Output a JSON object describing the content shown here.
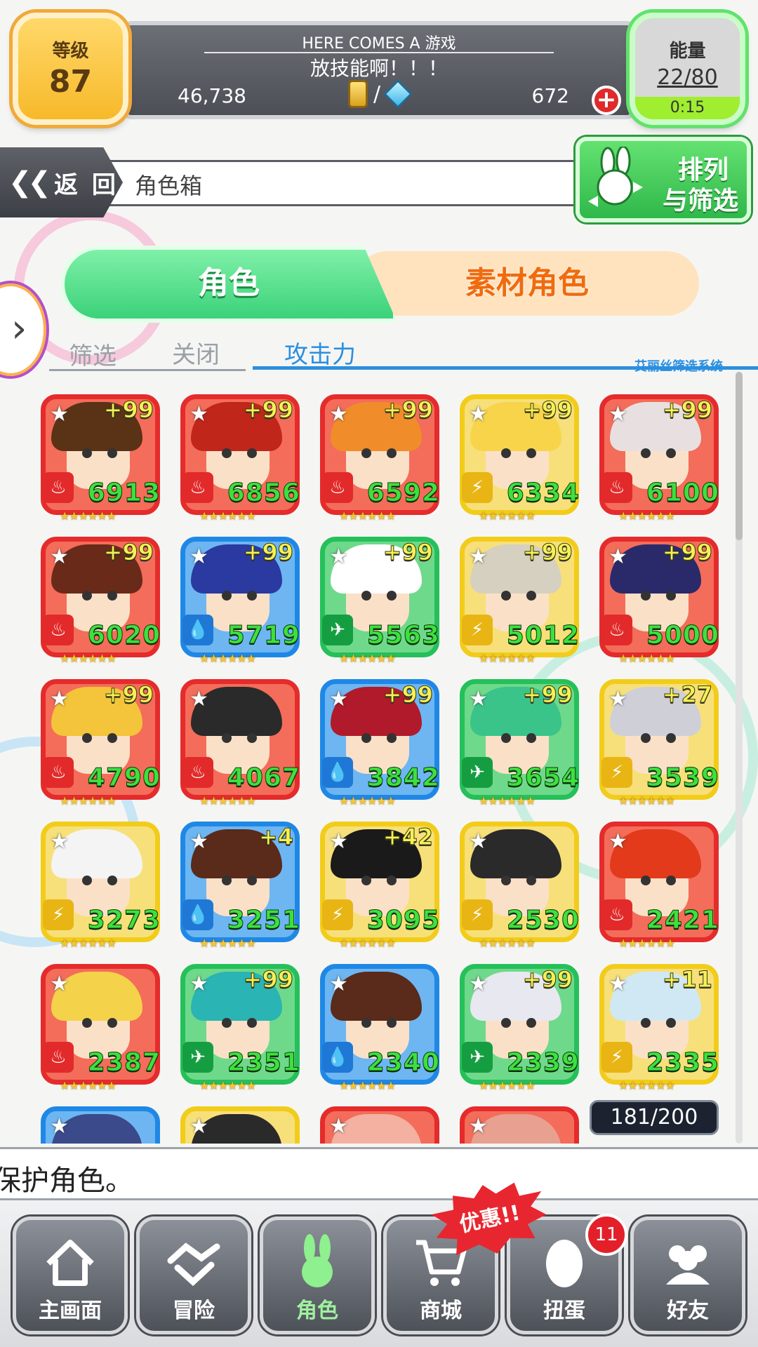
{
  "header": {
    "level_label": "等级",
    "level_value": "87",
    "game_title": "HERE COMES A 游戏",
    "game_subtitle": "放技能啊！！！",
    "coins": "46,738",
    "stones": "672",
    "currency_separator": "/",
    "plus_symbol": "+",
    "energy_label": "能量",
    "energy_value": "22/80",
    "energy_timer": "0:15"
  },
  "nav_header": {
    "back_label": "返 回",
    "back_chevron": "❮❮",
    "page_title": "角色箱",
    "sort_line1": "排列",
    "sort_line2": "与筛选"
  },
  "tabs": {
    "active": "角色",
    "inactive": "素材角色"
  },
  "side_arrow": "›",
  "filter": {
    "label": "筛选",
    "state": "关闭",
    "sort_by": "攻击力",
    "system_label": "艾丽丝筛选系统"
  },
  "characters": [
    {
      "plus": "+99",
      "power": "6913",
      "color": "red",
      "element": "fire"
    },
    {
      "plus": "+99",
      "power": "6856",
      "color": "red",
      "element": "fire"
    },
    {
      "plus": "+99",
      "power": "6592",
      "color": "red",
      "element": "fire"
    },
    {
      "plus": "+99",
      "power": "6334",
      "color": "yellow",
      "element": "thunder"
    },
    {
      "plus": "+99",
      "power": "6100",
      "color": "red",
      "element": "fire"
    },
    {
      "plus": "+99",
      "power": "6020",
      "color": "red",
      "element": "fire"
    },
    {
      "plus": "+99",
      "power": "5719",
      "color": "blue",
      "element": "water"
    },
    {
      "plus": "+99",
      "power": "5563",
      "color": "green",
      "element": "wind"
    },
    {
      "plus": "+99",
      "power": "5012",
      "color": "yellow",
      "element": "thunder"
    },
    {
      "plus": "+99",
      "power": "5000",
      "color": "red",
      "element": "fire"
    },
    {
      "plus": "+99",
      "power": "4790",
      "color": "red",
      "element": "fire"
    },
    {
      "plus": "",
      "power": "4067",
      "color": "red",
      "element": "fire"
    },
    {
      "plus": "+99",
      "power": "3842",
      "color": "blue",
      "element": "water"
    },
    {
      "plus": "+99",
      "power": "3654",
      "color": "green",
      "element": "wind"
    },
    {
      "plus": "+27",
      "power": "3539",
      "color": "yellow",
      "element": "thunder"
    },
    {
      "plus": "",
      "power": "3273",
      "color": "yellow",
      "element": "thunder"
    },
    {
      "plus": "+4",
      "power": "3251",
      "color": "blue",
      "element": "water"
    },
    {
      "plus": "+42",
      "power": "3095",
      "color": "yellow",
      "element": "thunder"
    },
    {
      "plus": "",
      "power": "2530",
      "color": "yellow",
      "element": "thunder"
    },
    {
      "plus": "",
      "power": "2421",
      "color": "red",
      "element": "fire"
    },
    {
      "plus": "",
      "power": "2387",
      "color": "red",
      "element": "fire"
    },
    {
      "plus": "+99",
      "power": "2351",
      "color": "green",
      "element": "wind"
    },
    {
      "plus": "",
      "power": "2340",
      "color": "blue",
      "element": "water"
    },
    {
      "plus": "+99",
      "power": "2339",
      "color": "green",
      "element": "wind"
    },
    {
      "plus": "+11",
      "power": "2335",
      "color": "yellow",
      "element": "thunder"
    },
    {
      "plus": "",
      "power": "",
      "color": "blue",
      "element": ""
    },
    {
      "plus": "",
      "power": "",
      "color": "yellow",
      "element": ""
    },
    {
      "plus": "",
      "power": "",
      "color": "red",
      "element": ""
    },
    {
      "plus": "",
      "power": "",
      "color": "red",
      "element": ""
    }
  ],
  "box_count": "181/200",
  "message": "保护角色。",
  "bottom_nav": [
    {
      "label": "主画面",
      "icon": "home-icon"
    },
    {
      "label": "冒险",
      "icon": "handshake-icon"
    },
    {
      "label": "角色",
      "icon": "bunny-icon",
      "active": true
    },
    {
      "label": "商城",
      "icon": "cart-icon"
    },
    {
      "label": "扭蛋",
      "icon": "egg-icon"
    },
    {
      "label": "好友",
      "icon": "friends-icon"
    }
  ],
  "sale_badge": "优惠!!",
  "gacha_notification": "11",
  "colors": {
    "fire": "#e22a2a",
    "water": "#1f78d6",
    "wind": "#159e41",
    "thunder": "#e8b514",
    "accent_green": "#3bd27a",
    "accent_orange": "#f06b0f"
  }
}
